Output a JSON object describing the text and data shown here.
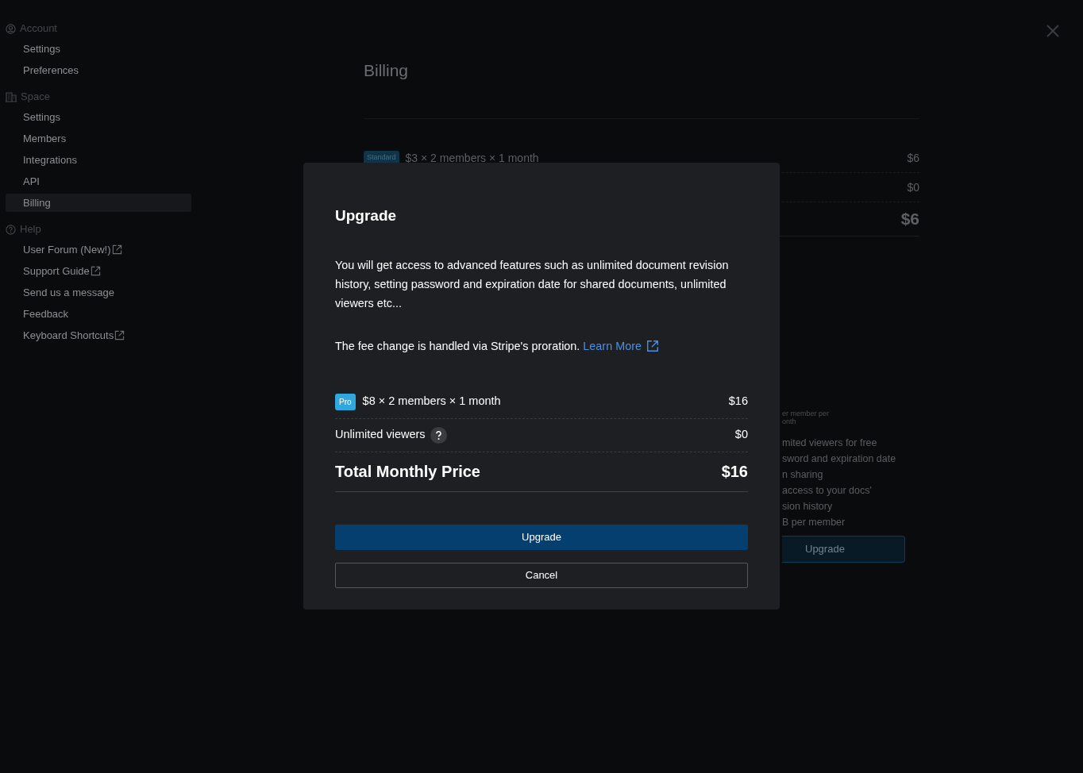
{
  "sidebar": {
    "sections": [
      {
        "title": "Account",
        "items": [
          {
            "label": "Settings",
            "selected": false,
            "external": false
          },
          {
            "label": "Preferences",
            "selected": false,
            "external": false
          }
        ]
      },
      {
        "title": "Space",
        "items": [
          {
            "label": "Settings",
            "selected": false,
            "external": false
          },
          {
            "label": "Members",
            "selected": false,
            "external": false
          },
          {
            "label": "Integrations",
            "selected": false,
            "external": false
          },
          {
            "label": "API",
            "selected": false,
            "external": false
          },
          {
            "label": "Billing",
            "selected": true,
            "external": false
          }
        ]
      },
      {
        "title": "Help",
        "items": [
          {
            "label": "User Forum (New!)",
            "selected": false,
            "external": true
          },
          {
            "label": "Support Guide",
            "selected": false,
            "external": true
          },
          {
            "label": "Send us a message",
            "selected": false,
            "external": false
          },
          {
            "label": "Feedback",
            "selected": false,
            "external": false
          },
          {
            "label": "Keyboard Shortcuts",
            "selected": false,
            "external": true
          }
        ]
      }
    ]
  },
  "page": {
    "title": "Billing",
    "summary": [
      {
        "kind": "plan",
        "badge": "Standard",
        "label": "$3 × 2 members × 1 month",
        "amount": "$6"
      },
      {
        "kind": "line",
        "amount": "$0"
      },
      {
        "kind": "total",
        "amount": "$6"
      }
    ],
    "plan_card": {
      "price_note": [
        "er member per",
        "onth"
      ],
      "features": [
        [
          "mited viewers for free"
        ],
        [
          "sword and expiration date",
          "n sharing"
        ],
        [
          "access to your docs'",
          "sion history"
        ],
        [
          "B per member"
        ]
      ],
      "button": "Upgrade"
    }
  },
  "modal": {
    "title": "Upgrade",
    "description": "You will get access to advanced features such as unlimited document revision history, setting password and expiration date for shared documents, unlimited viewers etc...",
    "note": {
      "text": "The fee change is handled via Stripe's proration.",
      "link": "Learn More"
    },
    "lines": [
      {
        "kind": "plan",
        "badge": "Pro",
        "label": "$8 × 2 members × 1 month",
        "amount": "$16"
      },
      {
        "kind": "line",
        "label": "Unlimited viewers",
        "help": true,
        "amount": "$0"
      },
      {
        "kind": "total",
        "label": "Total Monthly Price",
        "amount": "$16"
      }
    ],
    "buttons": [
      {
        "label": "Upgrade",
        "kind": "primary"
      },
      {
        "label": "Cancel",
        "kind": "outline"
      }
    ]
  }
}
